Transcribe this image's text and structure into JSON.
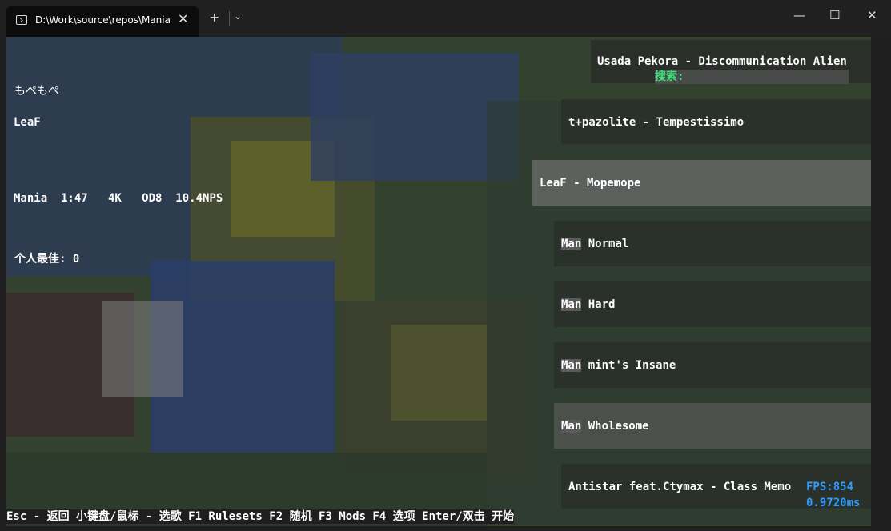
{
  "window": {
    "tab_title": "D:\\Work\\source\\repos\\Mania",
    "tab_close": "✕",
    "new_tab": "+",
    "dropdown": "⌄",
    "minimize": "—",
    "maximize": "☐",
    "close": "✕",
    "icons": {
      "tab": "terminal-icon"
    }
  },
  "info": {
    "title": "もぺもぺ",
    "artist": "LeaF",
    "stats": "Mania  1:47   4K   OD8  10.4NPS",
    "best_label": "个人最佳:",
    "best_value": "0"
  },
  "search": {
    "top_song": "Usada Pekora - Discommunication Alien",
    "label": "搜索:"
  },
  "list": {
    "items": [
      {
        "text": "t+pazolite - Tempestissimo"
      },
      {
        "text": "LeaF - Mopemope"
      },
      {
        "badge": "Man",
        "text": "Normal"
      },
      {
        "badge": "Man",
        "text": "Hard"
      },
      {
        "badge": "Man",
        "text": "mint's Insane"
      },
      {
        "badge": "Man",
        "text": "Wholesome"
      },
      {
        "text": "Antistar feat.Ctymax - Class Memo"
      }
    ]
  },
  "perf": {
    "fps": "FPS:854",
    "frametime": "0.9720ms"
  },
  "footer": {
    "hints": "Esc - 返回 小键盘/鼠标 - 选歌 F1 Rulesets F2 随机 F3 Mods F4 选项 Enter/双击 开始"
  },
  "colors": {
    "search_label": "#3ee07a",
    "fps": "#2f9bff",
    "selected_panel": "#6e6e6e"
  }
}
